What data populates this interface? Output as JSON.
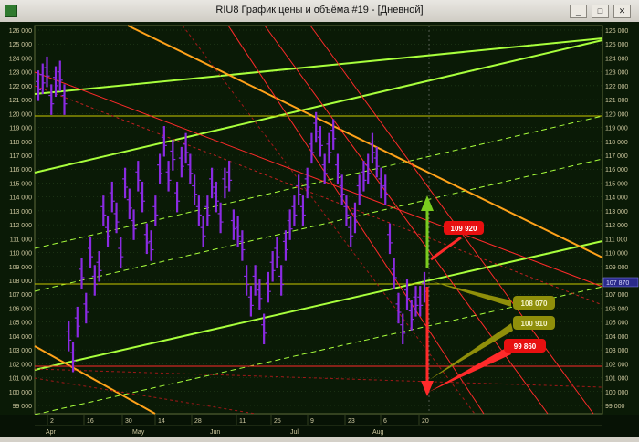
{
  "window": {
    "title": "RIU8 График цены и объёма #19 - [Дневной]",
    "buttons": {
      "minimize": "_",
      "restore": "□",
      "close": "✕"
    }
  },
  "colors": {
    "background": "#0a1a06",
    "bars": "#8a2be2",
    "axis_text": "#cfc9a0",
    "grid": "#2e4a22",
    "channel_green": "#a8ff3c",
    "channel_orange": "#ffa21a",
    "red_lines": "#ff2a2a",
    "olive_label": "#8f8f0a",
    "current_price_box": "#2a2a8a"
  },
  "price_axis": {
    "ticks": [
      "126 000",
      "125 000",
      "124 000",
      "123 000",
      "122 000",
      "121 000",
      "120 000",
      "119 000",
      "118 000",
      "117 000",
      "116 000",
      "115 000",
      "114 000",
      "113 000",
      "112 000",
      "111 000",
      "110 000",
      "109 000",
      "108 000",
      "107 000",
      "106 000",
      "105 000",
      "104 000",
      "103 000",
      "102 000",
      "101 000",
      "100 000",
      "99 000"
    ],
    "current_price": "107 870"
  },
  "time_axis": {
    "days": [
      "2",
      "16",
      "30",
      "14",
      "28",
      "11",
      "25",
      "9",
      "23",
      "6",
      "20"
    ],
    "months": [
      "Apr",
      "May",
      "Jun",
      "Jul",
      "Aug"
    ]
  },
  "annotations": [
    {
      "text": "109 920",
      "style": "red"
    },
    {
      "text": "108 070",
      "style": "olive"
    },
    {
      "text": "100 910",
      "style": "olive"
    },
    {
      "text": "99 860",
      "style": "red"
    }
  ],
  "chart_data": {
    "type": "bar",
    "ylim": [
      98800,
      126200
    ],
    "series": [
      {
        "values": [
          122000,
          122500,
          123000,
          121000,
          122300,
          122700,
          121000,
          104000,
          102500,
          105000,
          108500,
          106000,
          110000,
          108000,
          109000,
          113000,
          111500,
          114000,
          112500,
          110000,
          115000,
          113500,
          112000,
          115500,
          114000,
          111000,
          110500,
          113000,
          116000,
          118000,
          115500,
          117000,
          114000,
          116500,
          117500,
          116000,
          114500,
          113000,
          111500,
          113000,
          115000,
          114000,
          112500,
          115000,
          115500,
          112000,
          111500,
          110500,
          108000,
          106500,
          108000,
          107000,
          104500,
          107500,
          109000,
          110000,
          108000,
          110500,
          112000,
          113000,
          114500,
          113000,
          115000,
          117500,
          119000,
          118000,
          116000,
          117500,
          118500,
          116000,
          114500,
          113000,
          111500,
          112500,
          114500,
          115500,
          116000,
          117500,
          116500,
          115000,
          114500,
          111000,
          108500,
          106000,
          104500,
          107000,
          105500,
          106500,
          106500,
          107500
        ]
      }
    ]
  }
}
